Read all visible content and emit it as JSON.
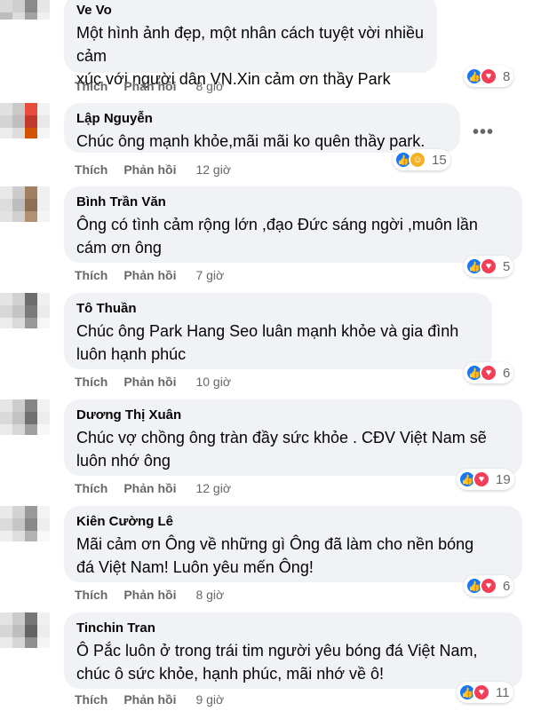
{
  "ui": {
    "like_label": "Thích",
    "reply_label": "Phản hồi",
    "more_icon": "more-horizontal-icon"
  },
  "colors": {
    "bubble": "#f0f2f5",
    "like": "#1877f2",
    "love": "#f33e58",
    "care": "#f7b125",
    "meta": "#65676b"
  },
  "comments": [
    {
      "name": "Ve Vo",
      "text_lines": [
        "Một hình ảnh đẹp, một nhân cách tuyệt vời nhiều cảm",
        "xúc với người dân VN.Xin cảm ơn thầy Park"
      ],
      "time": "8 giờ",
      "reactions": [
        "like",
        "love"
      ],
      "reaction_count": "8"
    },
    {
      "name": "Lập Nguyễn",
      "text_lines": [
        "Chúc ông mạnh khỏe,mãi mãi ko quên thầy park."
      ],
      "time": "12 giờ",
      "reactions": [
        "like",
        "care"
      ],
      "reaction_count": "15"
    },
    {
      "name": "Bình Trần Văn",
      "text_lines": [
        "Ông có tình cảm rộng lớn ,đạo Đức sáng ngời ,muôn lần",
        "cám ơn ông"
      ],
      "time": "7 giờ",
      "reactions": [
        "like",
        "love"
      ],
      "reaction_count": "5"
    },
    {
      "name": "Tô Thuần",
      "text_lines": [
        "Chúc ông Park Hang Seo luân mạnh khỏe và gia đình",
        "luôn hạnh phúc"
      ],
      "time": "10 giờ",
      "reactions": [
        "like",
        "love"
      ],
      "reaction_count": "6"
    },
    {
      "name": "Dương Thị Xuân",
      "text_lines": [
        "Chúc vợ chồng ông tràn đầy sức khỏe . CĐV Việt Nam sẽ",
        "luôn nhớ ông"
      ],
      "time": "12 giờ",
      "reactions": [
        "like",
        "love"
      ],
      "reaction_count": "19"
    },
    {
      "name": "Kiên Cường Lê",
      "text_lines": [
        "Mãi cảm ơn Ông về những gì Ông đã làm cho nền bóng",
        "đá Việt Nam! Luôn yêu mến Ông!"
      ],
      "time": "8 giờ",
      "reactions": [
        "like",
        "love"
      ],
      "reaction_count": "6"
    },
    {
      "name": "Tinchin Tran",
      "text_lines": [
        "Ô Pắc luôn ở trong trái tim người yêu bóng đá Việt Nam,",
        "chúc ô sức khỏe, hạnh phúc, mãi nhớ về ô!"
      ],
      "time": "9 giờ",
      "reactions": [
        "like",
        "love"
      ],
      "reaction_count": "11"
    }
  ]
}
